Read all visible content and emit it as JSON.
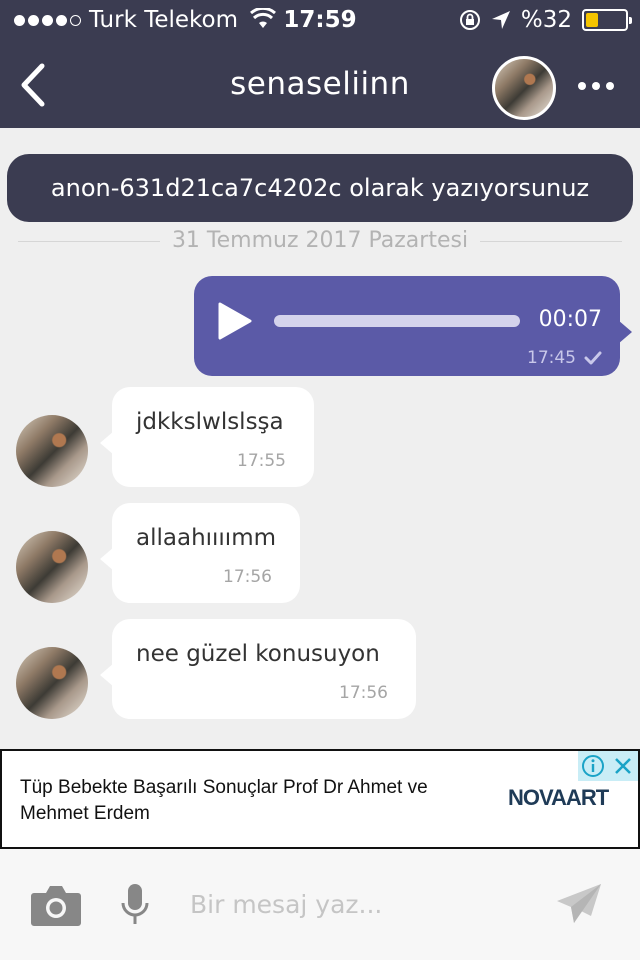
{
  "status_bar": {
    "carrier": "Turk Telekom",
    "time": "17:59",
    "battery": "%32",
    "battery_level": 0.32,
    "signal_bars": 4,
    "signal_total": 5
  },
  "header": {
    "title": "senaseliinn"
  },
  "identity_notice": "anon-631d21ca7c4202c olarak yazıyorsunuz",
  "date_separator": "31 Temmuz 2017 Pazartesi",
  "voice_message": {
    "duration": "00:07",
    "time": "17:45",
    "status": "sent"
  },
  "messages": [
    {
      "text": "jdkkslwlslsşa",
      "time": "17:55"
    },
    {
      "text": "allaahıııımm",
      "time": "17:56"
    },
    {
      "text": "nee güzel konusuyon",
      "time": "17:56"
    }
  ],
  "ad": {
    "text": "Tüp Bebekte Başarılı Sonuçlar Prof Dr Ahmet ve Mehmet Erdem",
    "advertiser_logo": "NOVAART"
  },
  "composer": {
    "placeholder": "Bir mesaj yaz..."
  },
  "colors": {
    "header": "#3b3c51",
    "outgoing_bubble": "#5b5aa7",
    "background": "#efefef",
    "battery": "#f5c400"
  }
}
